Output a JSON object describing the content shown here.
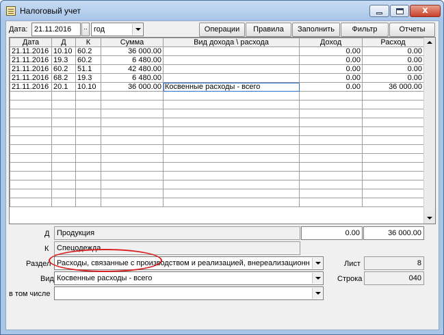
{
  "window": {
    "title": "Налоговый учет",
    "icons": {
      "app": "ledger-icon",
      "minimize": "minimize-icon",
      "maximize": "maximize-icon",
      "close": "close-icon"
    },
    "close_glyph": "x"
  },
  "toolbar": {
    "date_label": "Дата:",
    "date_value": "21.11.2016",
    "date_picker_label": "..",
    "period_value": "год",
    "buttons": [
      "Операции",
      "Правила",
      "Заполнить",
      "Фильтр",
      "Отчеты"
    ]
  },
  "table": {
    "headers": [
      "Дата",
      "Д",
      "К",
      "Сумма",
      "Вид дохода \\ расхода",
      "Доход",
      "Расход"
    ],
    "rows": [
      [
        "21.11.2016",
        "10.10",
        "60.2",
        "36 000.00",
        "",
        "0.00",
        "0.00"
      ],
      [
        "21.11.2016",
        "19.3",
        "60.2",
        "6 480.00",
        "",
        "0.00",
        "0.00"
      ],
      [
        "21.11.2016",
        "60.2",
        "51.1",
        "42 480.00",
        "",
        "0.00",
        "0.00"
      ],
      [
        "21.11.2016",
        "68.2",
        "19.3",
        "6 480.00",
        "",
        "0.00",
        "0.00"
      ],
      [
        "21.11.2016",
        "20.1",
        "10.10",
        "36 000.00",
        "Косвенные расходы - всего",
        "0.00",
        "36 000.00"
      ]
    ]
  },
  "details": {
    "d_label": "Д",
    "d_value": "Продукция",
    "k_label": "К",
    "k_value": "Спецодежда",
    "income_total": "0.00",
    "expense_total": "36 000.00",
    "razdel_label": "Раздел",
    "razdel_value": "Расходы, связанные с производством и реализацией, внереализационн",
    "vid_label": "Вид",
    "vid_value": "Косвенные расходы - всего",
    "vtom_label": "в том числе",
    "vtom_value": "",
    "list_label": "Лист",
    "list_value": "8",
    "stroka_label": "Строка",
    "stroka_value": "040"
  },
  "annotation_color": "#d81f1f"
}
